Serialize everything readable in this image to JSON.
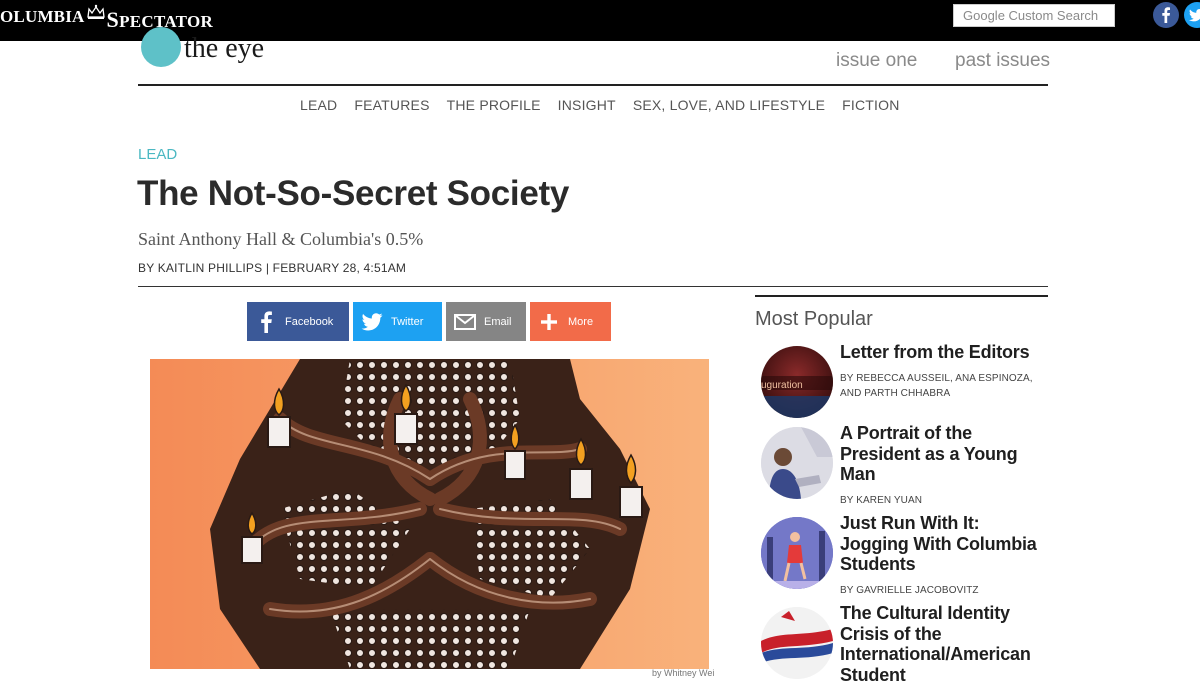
{
  "topbar": {
    "masthead_left": "OLUMBIA",
    "masthead_right_initial": "S",
    "masthead_right_rest": "PECTATOR",
    "search_placeholder": "Google Custom Search",
    "social_icons": [
      "facebook-icon",
      "twitter-icon"
    ],
    "colors": {
      "facebook": "#3b5998",
      "twitter": "#1da1f2"
    }
  },
  "header": {
    "logo_text": "the eye",
    "links": [
      "issue one",
      "past issues"
    ]
  },
  "nav": {
    "items": [
      "LEAD",
      "FEATURES",
      "THE PROFILE",
      "INSIGHT",
      "SEX, LOVE, AND LIFESTYLE",
      "FICTION"
    ]
  },
  "article": {
    "section": "LEAD",
    "title": "The Not-So-Secret Society",
    "subtitle": "Saint Anthony Hall & Columbia's 0.5%",
    "byline": "BY KAITLIN PHILLIPS | FEBRUARY 28, 4:51AM",
    "image_credit": "by Whitney Wei",
    "accent_color": "#4bb8c2"
  },
  "share": {
    "facebook": "Facebook",
    "twitter": "Twitter",
    "email": "Email",
    "more": "More"
  },
  "sidebar": {
    "heading": "Most Popular",
    "items": [
      {
        "title": "Letter from the Editors",
        "author": "BY REBECCA AUSSEIL, ANA ESPINOZA, AND PARTH CHHABRA",
        "thumb_text": "uguration"
      },
      {
        "title": "A Portrait of the President as a Young Man",
        "author": "BY KAREN YUAN"
      },
      {
        "title": "Just Run With It: Jogging With Columbia Students",
        "author": "BY GAVRIELLE JACOBOVITZ"
      },
      {
        "title": "The Cultural Identity Crisis of the International/American Student",
        "author": ""
      }
    ]
  }
}
